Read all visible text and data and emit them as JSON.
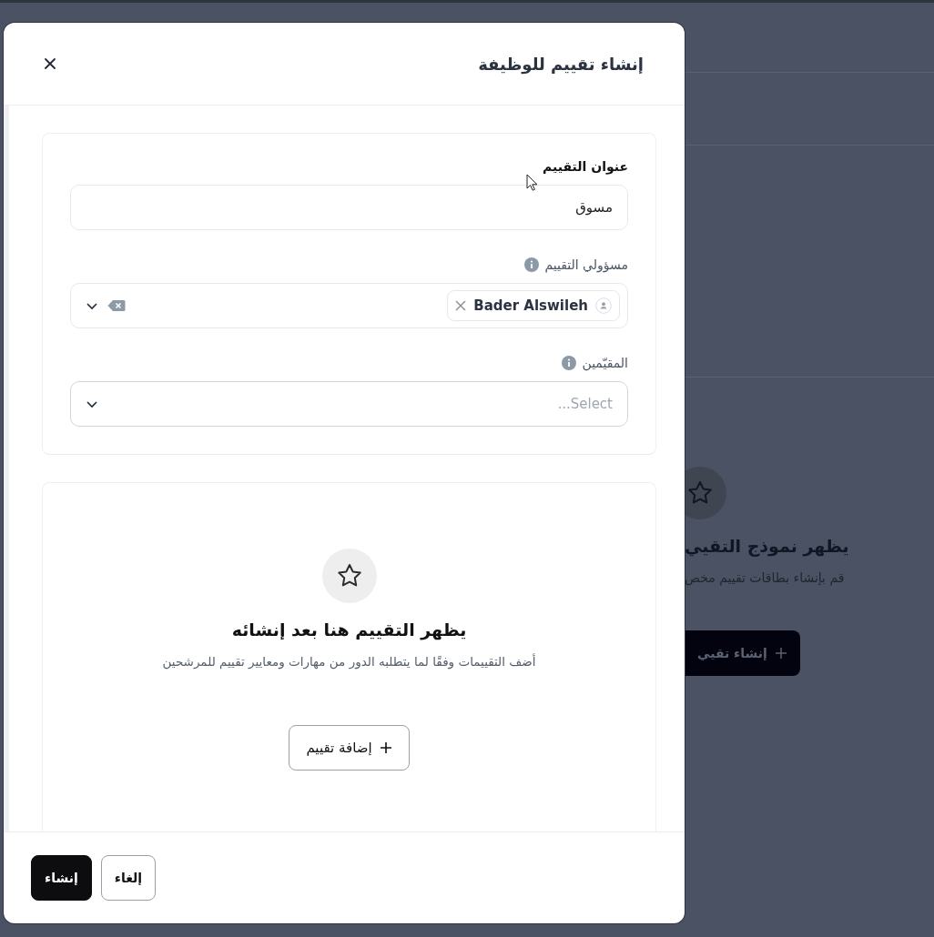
{
  "background_page": {
    "title": "يظهر نموذج التقيي",
    "description": "قم بإنشاء بطاقات تقييم مخص",
    "button": "إنشاء تقيي"
  },
  "dialog": {
    "title": "إنشاء تقييم للوظيفة"
  },
  "form": {
    "fields": [
      {
        "kind": "text",
        "label": "عنوان التقييم",
        "info": false,
        "value": "مسوق"
      },
      {
        "kind": "tags",
        "label": "مسؤولي التقييم",
        "info": true,
        "tags": [
          {
            "label": "Bader Alswileh"
          }
        ]
      },
      {
        "kind": "select",
        "label": "المقيّمين",
        "info": true,
        "placeholder": "Select..."
      }
    ]
  },
  "empty_state": {
    "title": "يظهر التقييم هنا بعد إنشائه",
    "description": "أضف التقييمات وفقًا لما يتطلبه الدور من مهارات ومعايير تقييم للمرشحين",
    "button": "إضافة تقييم"
  },
  "footer": {
    "buttons": [
      {
        "label": "إلغاء",
        "kind": "secondary"
      },
      {
        "label": "إنشاء",
        "kind": "primary"
      }
    ]
  }
}
